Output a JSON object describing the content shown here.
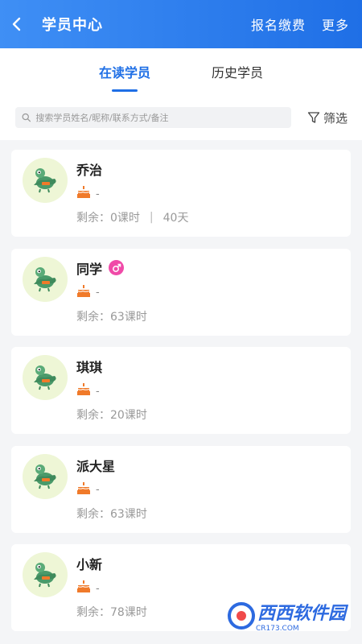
{
  "header": {
    "title": "学员中心",
    "actions": [
      "报名缴费",
      "更多"
    ]
  },
  "tabs": [
    {
      "label": "在读学员",
      "active": true
    },
    {
      "label": "历史学员",
      "active": false
    }
  ],
  "search": {
    "placeholder": "搜索学员姓名/昵称/联系方式/备注",
    "filter_label": "筛选"
  },
  "students": [
    {
      "name": "乔治",
      "birthday": "-",
      "remaining": "剩余：0课时",
      "extra": "40天",
      "gender": ""
    },
    {
      "name": "同学",
      "birthday": "-",
      "remaining": "剩余：63课时",
      "extra": "",
      "gender": "male"
    },
    {
      "name": "琪琪",
      "birthday": "-",
      "remaining": "剩余：20课时",
      "extra": "",
      "gender": ""
    },
    {
      "name": "派大星",
      "birthday": "-",
      "remaining": "剩余：63课时",
      "extra": "",
      "gender": ""
    },
    {
      "name": "小新",
      "birthday": "-",
      "remaining": "剩余：78课时",
      "extra": "",
      "gender": ""
    }
  ],
  "watermark": {
    "text": "西西软件园",
    "sub": "CR173.COM"
  },
  "colors": {
    "accent": "#1f6fe6",
    "header_gradient_start": "#3f8ff5",
    "gender_male": "#f04aa8",
    "cake": "#f07a2a"
  }
}
